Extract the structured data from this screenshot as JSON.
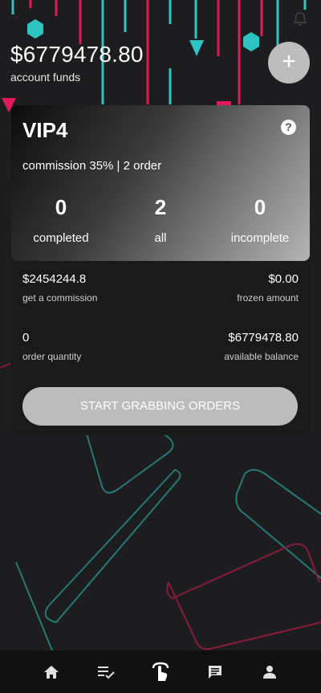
{
  "account": {
    "funds": "$6779478.80",
    "funds_label": "account funds",
    "add_label": "+"
  },
  "vip": {
    "level": "VIP4",
    "help_label": "?",
    "commission": "commission 35% | 2 order",
    "stats": [
      {
        "value": "0",
        "label": "completed"
      },
      {
        "value": "2",
        "label": "all"
      },
      {
        "value": "0",
        "label": "incomplete"
      }
    ]
  },
  "info": {
    "commission_value": "$2454244.8",
    "commission_label": "get a commission",
    "frozen_value": "$0.00",
    "frozen_label": "frozen amount",
    "order_quantity_value": "0",
    "order_quantity_label": "order quantity",
    "available_value": "$6779478.80",
    "available_label": "available balance"
  },
  "actions": {
    "grab_label": "START GRABBING ORDERS"
  },
  "nav": [
    {
      "icon": "home-icon"
    },
    {
      "icon": "order-list-icon"
    },
    {
      "icon": "tap-icon"
    },
    {
      "icon": "message-icon"
    },
    {
      "icon": "user-icon"
    }
  ],
  "colors": {
    "background": "#1d1d1f",
    "accent_cyan": "#2ec4c4",
    "accent_pink": "#e0195a",
    "button_grey": "#bcbcbc"
  }
}
